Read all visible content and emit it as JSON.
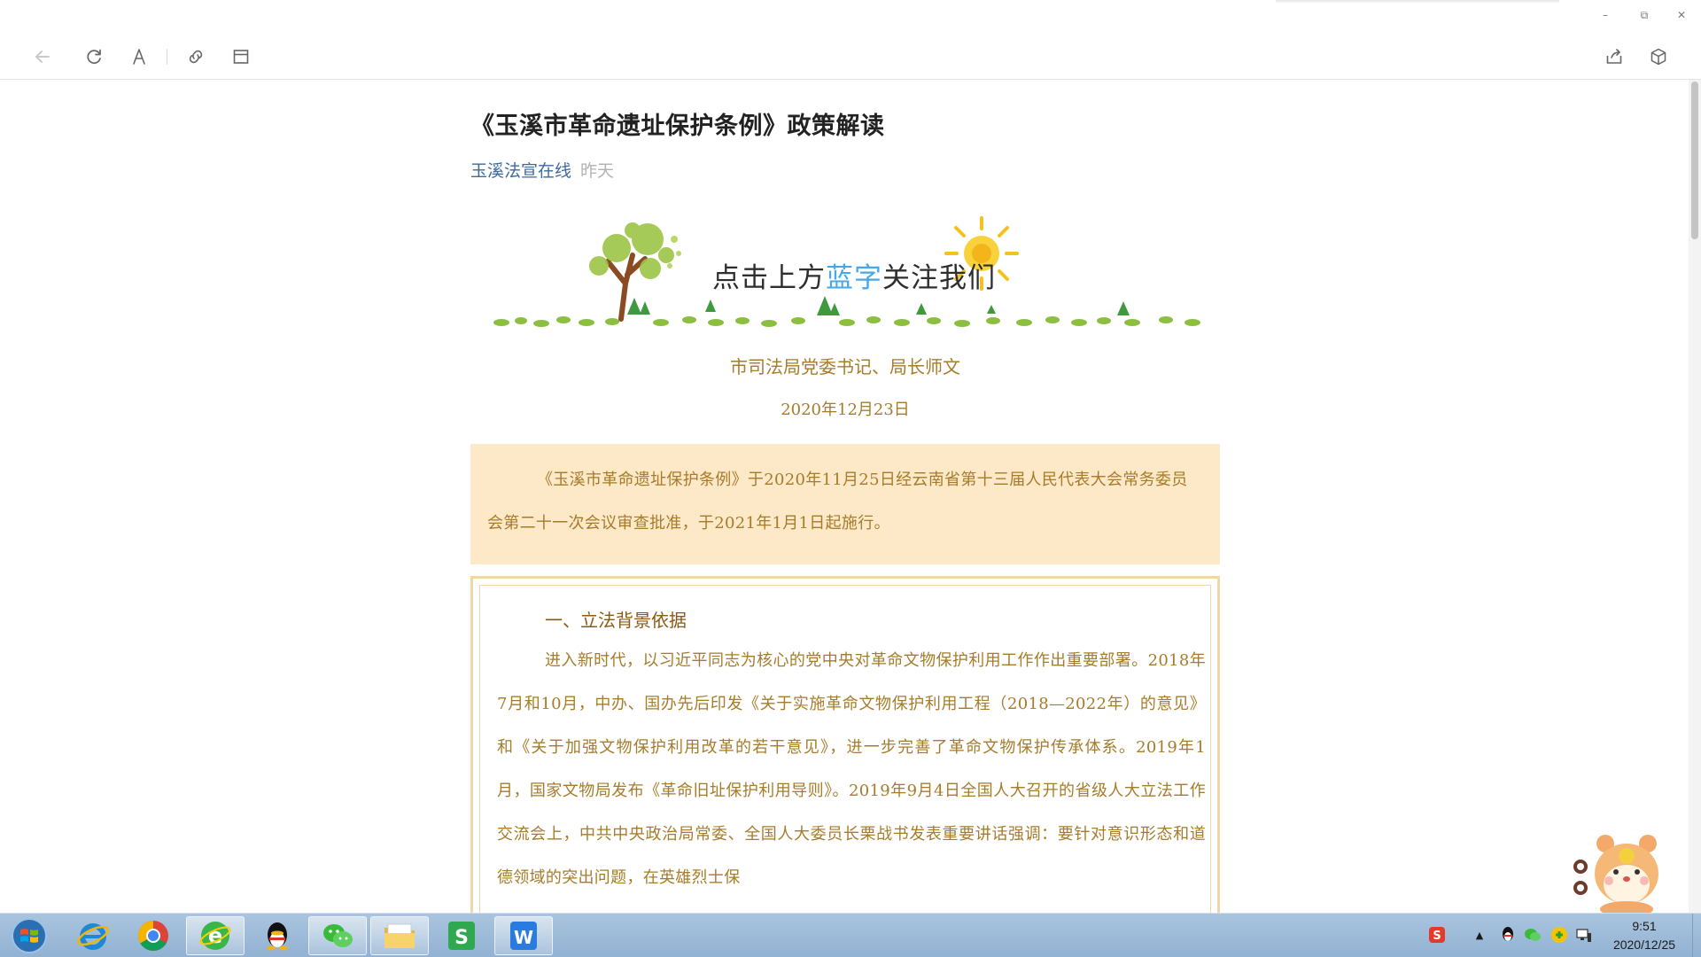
{
  "window": {
    "minimize_glyph": "–",
    "restore_glyph": "⧉",
    "close_glyph": "✕"
  },
  "toolbar": {
    "icons": [
      "back-arrow-icon",
      "refresh-icon",
      "font-size-icon",
      "copy-link-icon",
      "open-window-icon",
      "share-icon",
      "cube-icon"
    ]
  },
  "article": {
    "title": "《玉溪市革命遗址保护条例》政策解读",
    "author": "玉溪法宣在线",
    "date": "昨天",
    "banner": {
      "text_before": "点击上方",
      "text_accent": "蓝字",
      "text_after": "关注我们"
    },
    "byline": "市司法局党委书记、局长师文",
    "byline_date": "2020年12月23日",
    "summary": "《玉溪市革命遗址保护条例》于2020年11月25日经云南省第十三届人民代表大会常务委员会第二十一次会议审查批准，于2021年1月1日起施行。",
    "section_heading": "一、立法背景依据",
    "section_body": "进入新时代，以习近平同志为核心的党中央对革命文物保护利用工作作出重要部署。2018年7月和10月，中办、国办先后印发《关于实施革命文物保护利用工程（2018—2022年）的意见》和《关于加强文物保护利用改革的若干意见》，进一步完善了革命文物保护传承体系。2019年1月，国家文物局发布《革命旧址保护利用导则》。2019年9月4日全国人大召开的省级人大立法工作交流会上，中共中央政治局常委、全国人大委员长栗战书发表重要讲话强调：要针对意识形态和道德领域的突出问题，在英雄烈士保"
  },
  "colors": {
    "accent_blue": "#46a8e6",
    "author_link": "#3e6a9c",
    "body_brown": "#a67c2a",
    "summary_bg": "#fde8c8",
    "frame_border": "#f1d6a8"
  },
  "taskbar": {
    "apps": [
      "windows-start-icon",
      "internet-explorer-icon",
      "chrome-icon",
      "browser-e-icon",
      "qq-icon",
      "wechat-icon",
      "file-explorer-icon",
      "wps-spreadsheet-icon",
      "wps-writer-icon"
    ],
    "tray_icons": [
      "sogou-ime-icon",
      "tray-expand-icon",
      "qq-tray-icon",
      "wechat-tray-icon",
      "security-tray-icon",
      "network-icon"
    ],
    "tray_expand_glyph": "▲",
    "wps_s": "S",
    "wps_w": "W",
    "sogou_glyph": "S",
    "time": "9:51",
    "date": "2020/12/25"
  }
}
